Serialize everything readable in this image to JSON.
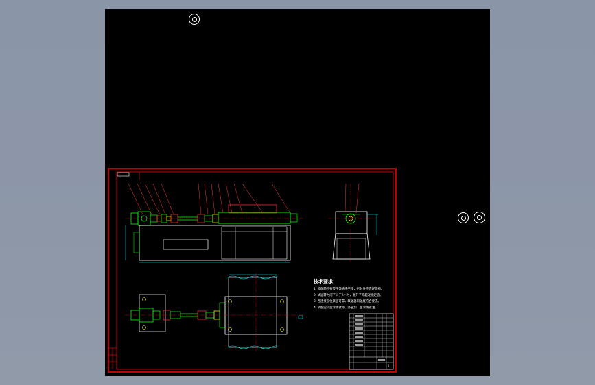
{
  "app": {
    "accent_background": "#8793a6",
    "viewport_background": "#000000"
  },
  "drawing": {
    "colors": {
      "frame": "#ff0000",
      "outline": "#ffffff",
      "parts": "#00ff00",
      "center_lines": "#ff0000",
      "dimensions": "#00ffff",
      "leaders": "#ff3333",
      "yellow": "#ffff00"
    },
    "tech_notes": {
      "title": "技术要求",
      "lines": [
        "1. 装配前所有零件须清洗干净，密封件应完好无损。",
        "2. 试运转时间不少于2小时，温升不得超过规定值。",
        "3. 各连接部位紧固可靠，联轴器同轴度符合要求。",
        "4. 装配完毕后涂防锈漆，外露加工面涂防锈油。"
      ]
    },
    "title_block": {
      "sheet_number": "1"
    }
  },
  "icons": {
    "top_circle": "view-cube-icon",
    "right_circle_a": "navigation-icon",
    "right_circle_b": "orbit-icon"
  }
}
